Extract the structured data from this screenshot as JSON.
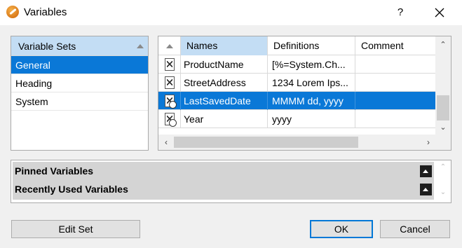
{
  "window": {
    "title": "Variables",
    "help_label": "?"
  },
  "variable_sets": {
    "header": "Variable Sets",
    "items": [
      "General",
      "Heading",
      "System"
    ],
    "selected_index": 0
  },
  "variables_grid": {
    "columns": [
      "Names",
      "Definitions",
      "Comment"
    ],
    "rows": [
      {
        "name": "ProductName",
        "definition": "[%=System.Ch...",
        "comment": "",
        "icon": "variable-icon"
      },
      {
        "name": "StreetAddress",
        "definition": "1234 Lorem Ips...",
        "comment": "",
        "icon": "variable-icon"
      },
      {
        "name": "LastSavedDate",
        "definition": "MMMM dd, yyyy",
        "comment": "",
        "icon": "date-variable-icon"
      },
      {
        "name": "Year",
        "definition": "yyyy",
        "comment": "",
        "icon": "date-variable-icon"
      }
    ],
    "selected_index": 2
  },
  "pinned": {
    "sections": [
      "Pinned Variables",
      "Recently Used Variables"
    ]
  },
  "buttons": {
    "edit_set": "Edit Set",
    "ok": "OK",
    "cancel": "Cancel"
  },
  "colors": {
    "selection": "#0a78d7",
    "header_highlight": "#c3ddf4",
    "dialog_bg": "#f0f0f0"
  }
}
